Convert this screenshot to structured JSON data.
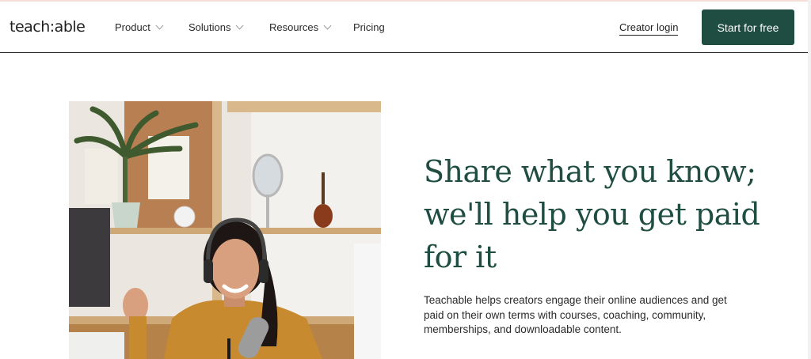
{
  "header": {
    "logo": "teach:able",
    "nav": [
      {
        "label": "Product",
        "has_dropdown": true
      },
      {
        "label": "Solutions",
        "has_dropdown": true
      },
      {
        "label": "Resources",
        "has_dropdown": true
      },
      {
        "label": "Pricing",
        "has_dropdown": false
      }
    ],
    "login_label": "Creator login",
    "cta_label": "Start for free"
  },
  "hero": {
    "headline": "Share what you know; we'll help you get paid for it",
    "subtext": "Teachable helps creators engage their online audiences and get paid on their own terms with courses, coaching, community, memberships, and downloadable content."
  },
  "colors": {
    "brand_green": "#1f4d42",
    "text": "#1f1f1f",
    "photo_accent": "#c88a2e"
  }
}
